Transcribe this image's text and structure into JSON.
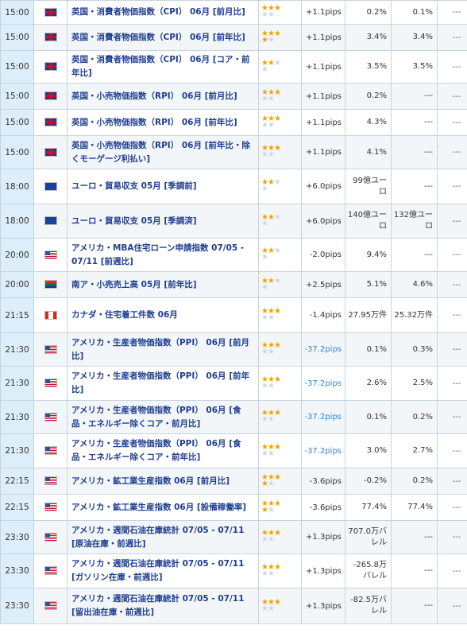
{
  "rows": [
    {
      "time": "15:00",
      "flag": "uk",
      "event": "英国・消費者物価指数（CPI） 06月 [前月比]",
      "stars": [
        3,
        0,
        2
      ],
      "pips": "+1.1pips",
      "pips_neg": false,
      "prev": "0.2%",
      "fcst": "0.1%",
      "res": "---",
      "h": 30
    },
    {
      "time": "15:00",
      "flag": "uk",
      "event": "英国・消費者物価指数（CPI） 06月 [前年比]",
      "stars": [
        3,
        1,
        1
      ],
      "pips": "+1.1pips",
      "pips_neg": false,
      "prev": "3.4%",
      "fcst": "3.4%",
      "res": "---",
      "h": 33
    },
    {
      "time": "15:00",
      "flag": "uk",
      "event": "英国・消費者物価指数（CPI） 06月 [コア・前年比]",
      "stars": [
        2,
        0,
        2
      ],
      "pips": "+1.1pips",
      "pips_neg": false,
      "prev": "3.5%",
      "fcst": "3.5%",
      "res": "---",
      "h": 41
    },
    {
      "time": "15:00",
      "flag": "uk",
      "event": "英国・小売物価指数（RPI） 06月 [前月比]",
      "stars": [
        3,
        0,
        2
      ],
      "pips": "+1.1pips",
      "pips_neg": false,
      "prev": "0.2%",
      "fcst": "---",
      "res": "---",
      "h": 33
    },
    {
      "time": "15:00",
      "flag": "uk",
      "event": "英国・小売物価指数（RPI） 06月 [前年比]",
      "stars": [
        3,
        0,
        2
      ],
      "pips": "+1.1pips",
      "pips_neg": false,
      "prev": "4.3%",
      "fcst": "---",
      "res": "---",
      "h": 33
    },
    {
      "time": "15:00",
      "flag": "uk",
      "event": "英国・小売物価指数（RPI） 06月 [前年比・除くモーゲージ利払い]",
      "stars": [
        3,
        0,
        2
      ],
      "pips": "+1.1pips",
      "pips_neg": false,
      "prev": "4.1%",
      "fcst": "---",
      "res": "---",
      "h": 42
    },
    {
      "time": "18:00",
      "flag": "eu",
      "event": "ユーロ・貿易収支 05月 [季調前]",
      "stars": [
        2,
        0,
        2
      ],
      "pips": "+6.0pips",
      "pips_neg": false,
      "prev": "99億ユーロ",
      "fcst": "---",
      "res": "---",
      "h": 44
    },
    {
      "time": "18:00",
      "flag": "eu",
      "event": "ユーロ・貿易収支 05月 [季調済]",
      "stars": [
        2,
        0,
        2
      ],
      "pips": "+6.0pips",
      "pips_neg": false,
      "prev": "140億ユーロ",
      "fcst": "132億ユーロ",
      "res": "---",
      "h": 43
    },
    {
      "time": "20:00",
      "flag": "us",
      "event": "アメリカ・MBA住宅ローン申請指数 07/05 - 07/11 [前週比]",
      "stars": [
        2,
        0,
        2
      ],
      "pips": "-2.0pips",
      "pips_neg": false,
      "prev": "9.4%",
      "fcst": "---",
      "res": "---",
      "h": 42
    },
    {
      "time": "20:00",
      "flag": "za",
      "event": "南ア・小売売上高 05月 [前年比]",
      "stars": [
        2,
        0,
        2
      ],
      "pips": "+2.5pips",
      "pips_neg": false,
      "prev": "5.1%",
      "fcst": "4.6%",
      "res": "---",
      "h": 33
    },
    {
      "time": "21:15",
      "flag": "ca",
      "event": "カナダ・住宅着工件数 06月",
      "stars": [
        3,
        0,
        2
      ],
      "pips": "-1.4pips",
      "pips_neg": false,
      "prev": "27.95万件",
      "fcst": "25.32万件",
      "res": "---",
      "h": 44
    },
    {
      "time": "21:30",
      "flag": "us",
      "event": "アメリカ・生産者物価指数（PPI） 06月 [前月比]",
      "stars": [
        3,
        0,
        2
      ],
      "pips": "-37.2pips",
      "pips_neg": true,
      "prev": "0.1%",
      "fcst": "0.3%",
      "res": "---",
      "h": 42
    },
    {
      "time": "21:30",
      "flag": "us",
      "event": "アメリカ・生産者物価指数（PPI） 06月 [前年比]",
      "stars": [
        3,
        0,
        2
      ],
      "pips": "-37.2pips",
      "pips_neg": true,
      "prev": "2.6%",
      "fcst": "2.5%",
      "res": "---",
      "h": 43
    },
    {
      "time": "21:30",
      "flag": "us",
      "event": "アメリカ・生産者物価指数（PPI） 06月 [食品・エネルギー除くコア・前月比]",
      "stars": [
        3,
        0,
        2
      ],
      "pips": "-37.2pips",
      "pips_neg": true,
      "prev": "0.1%",
      "fcst": "0.2%",
      "res": "---",
      "h": 42
    },
    {
      "time": "21:30",
      "flag": "us",
      "event": "アメリカ・生産者物価指数（PPI） 06月 [食品・エネルギー除くコア・前年比]",
      "stars": [
        3,
        0,
        2
      ],
      "pips": "-37.2pips",
      "pips_neg": true,
      "prev": "3.0%",
      "fcst": "2.7%",
      "res": "---",
      "h": 43
    },
    {
      "time": "22:15",
      "flag": "us",
      "event": "アメリカ・鉱工業生産指数 06月 [前月比]",
      "stars": [
        3,
        1,
        1
      ],
      "pips": "-3.6pips",
      "pips_neg": false,
      "prev": "-0.2%",
      "fcst": "0.2%",
      "res": "---",
      "h": 33
    },
    {
      "time": "22:15",
      "flag": "us",
      "event": "アメリカ・鉱工業生産指数 06月 [設備稼働率]",
      "stars": [
        3,
        1,
        1
      ],
      "pips": "-3.6pips",
      "pips_neg": false,
      "prev": "77.4%",
      "fcst": "77.4%",
      "res": "---",
      "h": 33
    },
    {
      "time": "23:30",
      "flag": "us",
      "event": "アメリカ・週間石油在庫統計 07/05 - 07/11 [原油在庫・前週比]",
      "stars": [
        3,
        0,
        2
      ],
      "pips": "+1.3pips",
      "pips_neg": false,
      "prev": "707.0万バレル",
      "fcst": "---",
      "res": "---",
      "h": 42
    },
    {
      "time": "23:30",
      "flag": "us",
      "event": "アメリカ・週間石油在庫統計 07/05 - 07/11 [ガソリン在庫・前週比]",
      "stars": [
        3,
        0,
        2
      ],
      "pips": "+1.3pips",
      "pips_neg": false,
      "prev": "-265.8万バレル",
      "fcst": "---",
      "res": "---",
      "h": 43
    },
    {
      "time": "23:30",
      "flag": "us",
      "event": "アメリカ・週間石油在庫統計 07/05 - 07/11 [留出油在庫・前週比]",
      "stars": [
        3,
        0,
        2
      ],
      "pips": "+1.3pips",
      "pips_neg": false,
      "prev": "-82.5万バレル",
      "fcst": "---",
      "res": "---",
      "h": 45
    }
  ]
}
